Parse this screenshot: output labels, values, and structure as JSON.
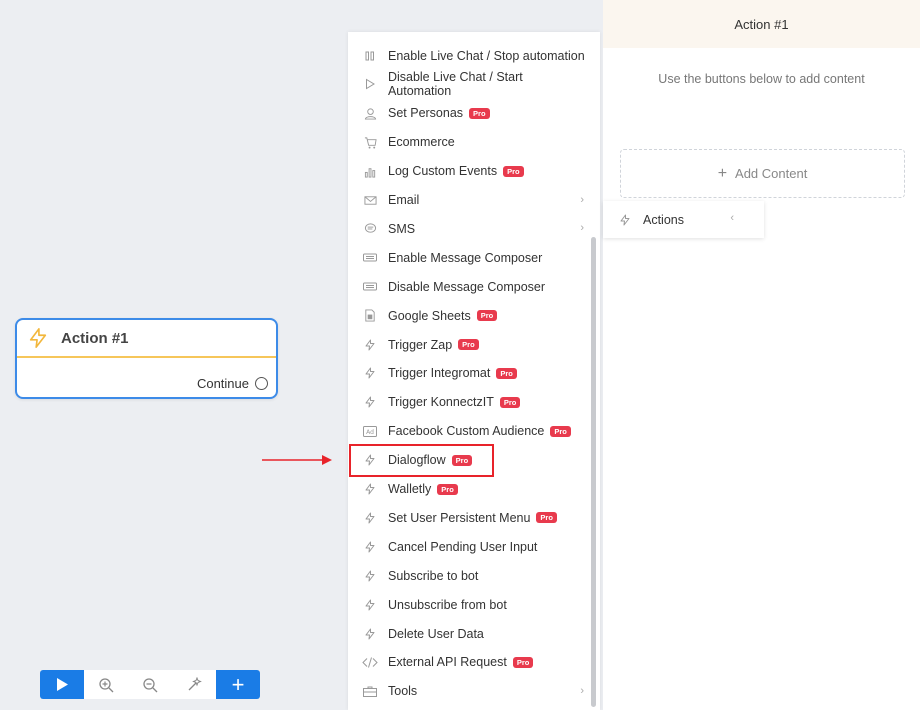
{
  "node": {
    "title": "Action #1",
    "continue_label": "Continue"
  },
  "menu": {
    "items": [
      {
        "label": "Enable Live Chat / Stop automation",
        "icon": "pause-icon",
        "pro": false,
        "submenu": false
      },
      {
        "label": "Disable Live Chat / Start Automation",
        "icon": "play-outline-icon",
        "pro": false,
        "submenu": false
      },
      {
        "label": "Set Personas",
        "icon": "user-icon",
        "pro": true,
        "submenu": false
      },
      {
        "label": "Ecommerce",
        "icon": "cart-icon",
        "pro": false,
        "submenu": false
      },
      {
        "label": "Log Custom Events",
        "icon": "chart-icon",
        "pro": true,
        "submenu": false
      },
      {
        "label": "Email",
        "icon": "mail-icon",
        "pro": false,
        "submenu": true
      },
      {
        "label": "SMS",
        "icon": "sms-icon",
        "pro": false,
        "submenu": true
      },
      {
        "label": "Enable Message Composer",
        "icon": "keyboard-icon",
        "pro": false,
        "submenu": false
      },
      {
        "label": "Disable Message Composer",
        "icon": "keyboard-icon",
        "pro": false,
        "submenu": false
      },
      {
        "label": "Google Sheets",
        "icon": "sheet-icon",
        "pro": true,
        "submenu": false
      },
      {
        "label": "Trigger Zap",
        "icon": "bolt-icon",
        "pro": true,
        "submenu": false
      },
      {
        "label": "Trigger Integromat",
        "icon": "bolt-icon",
        "pro": true,
        "submenu": false
      },
      {
        "label": "Trigger KonnectzIT",
        "icon": "bolt-icon",
        "pro": true,
        "submenu": false
      },
      {
        "label": "Facebook Custom Audience",
        "icon": "ad-icon",
        "pro": true,
        "submenu": false
      },
      {
        "label": "Dialogflow",
        "icon": "bolt-icon",
        "pro": true,
        "submenu": false
      },
      {
        "label": "Walletly",
        "icon": "bolt-icon",
        "pro": true,
        "submenu": false
      },
      {
        "label": "Set User Persistent Menu",
        "icon": "bolt-icon",
        "pro": true,
        "submenu": false
      },
      {
        "label": "Cancel Pending User Input",
        "icon": "bolt-icon",
        "pro": false,
        "submenu": false
      },
      {
        "label": "Subscribe to bot",
        "icon": "bolt-icon",
        "pro": false,
        "submenu": false
      },
      {
        "label": "Unsubscribe from bot",
        "icon": "bolt-icon",
        "pro": false,
        "submenu": false
      },
      {
        "label": "Delete User Data",
        "icon": "bolt-icon",
        "pro": false,
        "submenu": false
      },
      {
        "label": "External API Request",
        "icon": "code-icon",
        "pro": true,
        "submenu": false
      },
      {
        "label": "Tools",
        "icon": "toolbox-icon",
        "pro": false,
        "submenu": true
      }
    ],
    "pro_label": "Pro"
  },
  "panel": {
    "title": "Action #1",
    "hint": "Use the buttons below to add content",
    "add_content_label": "Add Content"
  },
  "actions_button": {
    "label": "Actions"
  },
  "toolbar": {
    "plus": "+"
  },
  "colors": {
    "accent": "#1a7ce6",
    "pro_badge": "#e83a4d",
    "highlight": "#e8232a",
    "node_border": "#3d8be8",
    "node_divider": "#f6c65a"
  }
}
